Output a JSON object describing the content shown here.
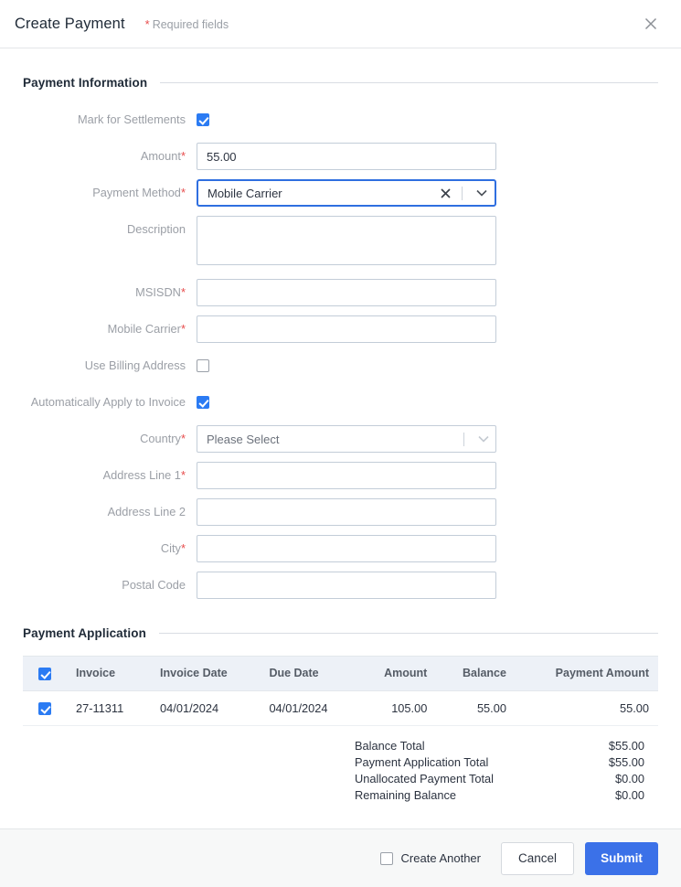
{
  "header": {
    "title": "Create Payment",
    "required_note": "Required fields",
    "required_asterisk": "*",
    "close_icon": "close-icon"
  },
  "sections": {
    "payment_information": "Payment Information",
    "payment_application": "Payment Application"
  },
  "form": {
    "mark_for_settlements": {
      "label": "Mark for Settlements",
      "checked": true
    },
    "amount": {
      "label": "Amount",
      "required": true,
      "value": "55.00"
    },
    "payment_method": {
      "label": "Payment Method",
      "required": true,
      "value": "Mobile Carrier",
      "focused": true,
      "clear_icon": "close-icon",
      "chevron_icon": "chevron-down-icon"
    },
    "description": {
      "label": "Description",
      "required": false,
      "value": ""
    },
    "msisdn": {
      "label": "MSISDN",
      "required": true,
      "value": ""
    },
    "mobile_carrier": {
      "label": "Mobile Carrier",
      "required": true,
      "value": ""
    },
    "use_billing_address": {
      "label": "Use Billing Address",
      "checked": false
    },
    "automatically_apply_to_invoice": {
      "label": "Automatically Apply to Invoice",
      "checked": true
    },
    "country": {
      "label": "Country",
      "required": true,
      "value": "Please Select",
      "chevron_icon": "chevron-down-icon"
    },
    "address_line_1": {
      "label": "Address Line 1",
      "required": true,
      "value": ""
    },
    "address_line_2": {
      "label": "Address Line 2",
      "required": false,
      "value": ""
    },
    "city": {
      "label": "City",
      "required": true,
      "value": ""
    },
    "postal_code": {
      "label": "Postal Code",
      "required": false,
      "value": ""
    }
  },
  "table": {
    "select_all_checked": true,
    "columns": [
      "",
      "Invoice",
      "Invoice Date",
      "Due Date",
      "Amount",
      "Balance",
      "Payment Amount"
    ],
    "rows": [
      {
        "checked": true,
        "invoice": "27-11311",
        "invoice_date": "04/01/2024",
        "due_date": "04/01/2024",
        "amount": "105.00",
        "balance": "55.00",
        "payment_amount": "55.00"
      }
    ]
  },
  "totals": [
    {
      "label": "Balance Total",
      "value": "$55.00"
    },
    {
      "label": "Payment Application Total",
      "value": "$55.00"
    },
    {
      "label": "Unallocated Payment Total",
      "value": "$0.00"
    },
    {
      "label": "Remaining Balance",
      "value": "$0.00"
    }
  ],
  "footer": {
    "create_another": {
      "label": "Create Another",
      "checked": false
    },
    "cancel_label": "Cancel",
    "submit_label": "Submit"
  },
  "colors": {
    "accent_blue": "#3b71e8",
    "checkbox_blue": "#2b7bf3",
    "focus_blue": "#2f6fe0",
    "required_red": "#e74c4c",
    "table_header_bg": "#edf1f7",
    "footer_bg": "#f7f8f8"
  }
}
